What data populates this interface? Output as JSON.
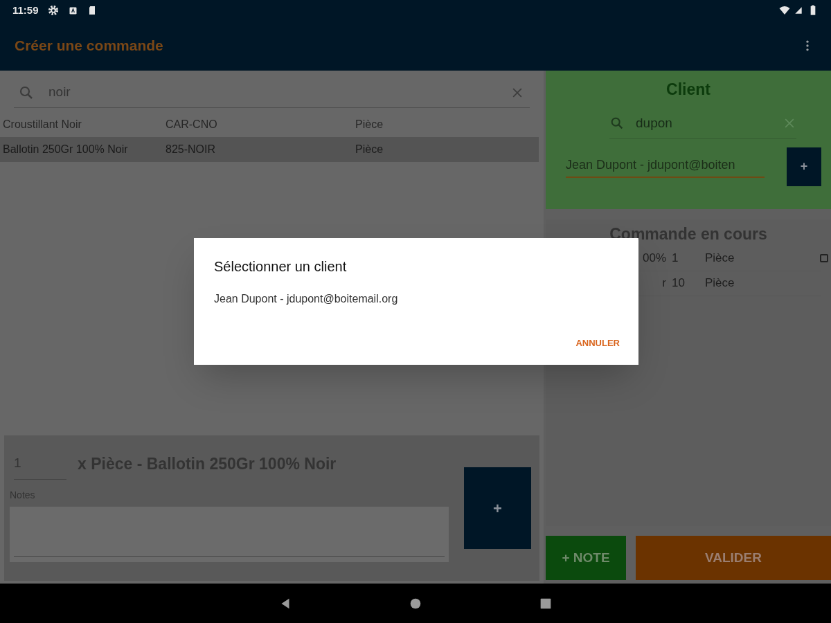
{
  "status_bar": {
    "time": "11:59"
  },
  "app_bar": {
    "title": "Créer une commande"
  },
  "product_search": {
    "value": "noir"
  },
  "products": [
    {
      "name": "Croustillant Noir",
      "code": "CAR-CNO",
      "unit": "Pièce",
      "selected": false
    },
    {
      "name": "Ballotin 250Gr 100% Noir",
      "code": "825-NOIR",
      "unit": "Pièce",
      "selected": true
    }
  ],
  "line_editor": {
    "quantity": "1",
    "description": "x Pièce - Ballotin 250Gr 100% Noir",
    "notes_label": "Notes",
    "add_button": "+"
  },
  "client": {
    "title": "Client",
    "search": "dupon",
    "selected_client": "Jean Dupont - jdupont@boiten",
    "add_button": "+"
  },
  "order": {
    "title": "Commande en cours",
    "rows": [
      {
        "product": "00%",
        "quantity": "1",
        "unit": "Pièce",
        "marked": true
      },
      {
        "product": "r",
        "quantity": "10",
        "unit": "Pièce",
        "marked": false
      }
    ]
  },
  "buttons": [
    {
      "label": "+ NOTE",
      "kind": "note"
    },
    {
      "label": "VALIDER",
      "kind": "validate"
    }
  ],
  "dialog": {
    "title": "Sélectionner un client",
    "items": [
      "Jean Dupont - jdupont@boitemail.org"
    ],
    "cancel": "ANNULER"
  }
}
